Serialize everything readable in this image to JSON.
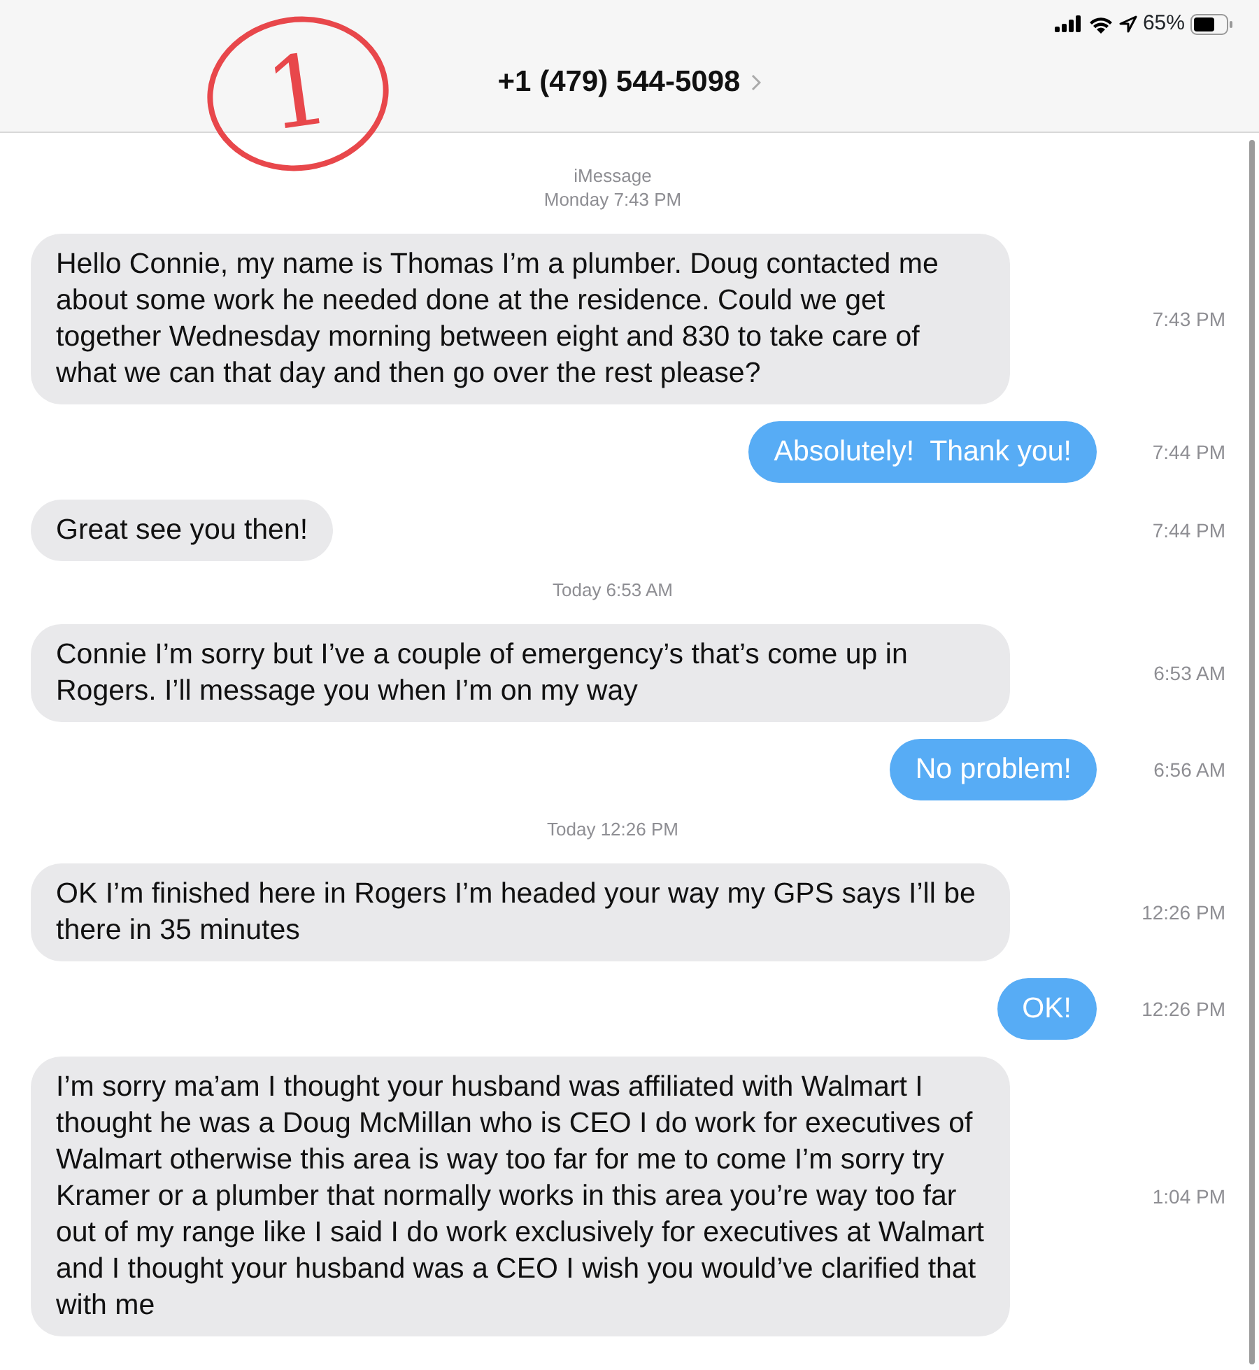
{
  "status_bar": {
    "battery_percent": "65%"
  },
  "header": {
    "title": "+1 (479) 544-5098"
  },
  "annotation": {
    "label": "1"
  },
  "messages": [
    {
      "kind": "stamp",
      "lines": [
        "iMessage",
        "Monday 7:43 PM"
      ]
    },
    {
      "kind": "incoming",
      "text": "Hello Connie, my name is Thomas I’m a plumber. Doug contacted me about some work he needed done at the residence. Could we get together Wednesday morning between eight and 830 to take care of what we can that day and then go over the rest please?",
      "time": "7:43 PM"
    },
    {
      "kind": "outgoing",
      "text": "Absolutely!  Thank you!",
      "time": "7:44 PM"
    },
    {
      "kind": "incoming",
      "text": "Great see you then!",
      "time": "7:44 PM"
    },
    {
      "kind": "stamp",
      "lines": [
        "Today 6:53 AM"
      ]
    },
    {
      "kind": "incoming",
      "text": "Connie I’m sorry but I’ve a couple of emergency’s that’s come up in Rogers. I’ll message you when I’m on my way",
      "time": "6:53 AM"
    },
    {
      "kind": "outgoing",
      "text": "No problem!",
      "time": "6:56 AM"
    },
    {
      "kind": "stamp",
      "lines": [
        "Today 12:26 PM"
      ]
    },
    {
      "kind": "incoming",
      "text": "OK I’m finished here in Rogers I’m headed your way my GPS says I’ll be there in 35 minutes",
      "time": "12:26 PM"
    },
    {
      "kind": "outgoing",
      "text": "OK!",
      "time": "12:26 PM"
    },
    {
      "kind": "incoming",
      "text": "I’m sorry ma’am I thought your husband was affiliated with Walmart I thought he was a Doug McMillan who is CEO I do work for executives of Walmart otherwise this area is way too far for me to come I’m sorry try Kramer or a plumber that normally works in this area you’re way too far out of my range like I said I do work exclusively for executives at Walmart and I thought your husband was a CEO I wish you would’ve clarified that with me",
      "time": "1:04 PM"
    }
  ]
}
